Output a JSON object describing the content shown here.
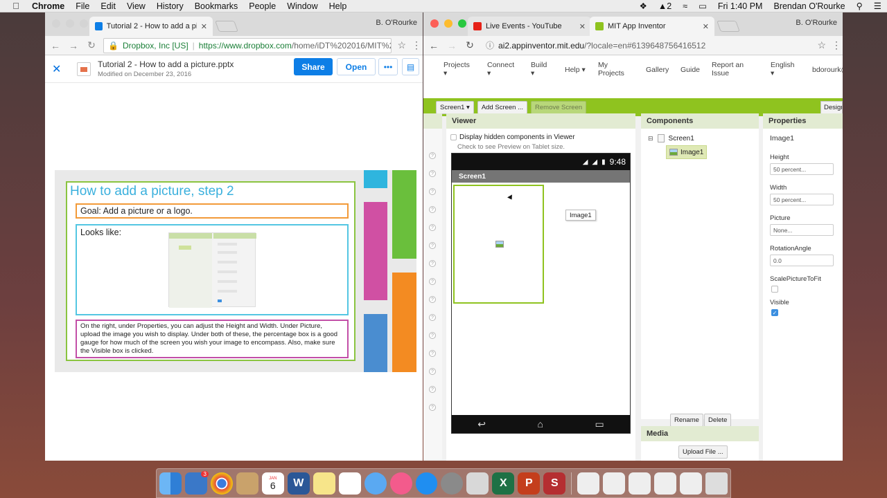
{
  "menubar": {
    "app": "Chrome",
    "items": [
      "File",
      "Edit",
      "View",
      "History",
      "Bookmarks",
      "People",
      "Window",
      "Help"
    ],
    "time": "Fri 1:40 PM",
    "user": "Brendan O'Rourke",
    "notification_count": "2"
  },
  "left_window": {
    "tab_title": "Tutorial 2 - How to add a pictu",
    "profile": "B. O'Rourke",
    "site_owner": "Dropbox, Inc [US]",
    "url_host": "https://www.dropbox.com",
    "url_path": "/home/iDT%202016/MIT%20A...",
    "file_title": "Tutorial 2 - How to add a picture.pptx",
    "file_modified": "Modified on December 23, 2016",
    "share_label": "Share",
    "open_label": "Open",
    "more_label": "•••",
    "slide": {
      "title": "How to add a picture, step 2",
      "goal": "Goal:  Add a picture or a logo.",
      "looks_like": "Looks like:",
      "paragraph": "On the right, under Properties, you can adjust the Height and Width.  Under Picture, upload the image you wish to display.  Under both of these, the percentage box is a good gauge for how much of the screen you wish your image to encompass.  Also, make sure the Visible box is clicked."
    }
  },
  "right_window": {
    "tabs": [
      {
        "title": "Live Events - YouTube"
      },
      {
        "title": "MIT App Inventor"
      }
    ],
    "profile": "B. O'Rourke",
    "url_host": "ai2.appinventor.mit.edu",
    "url_path": "/?locale=en#6139648756416512",
    "nav": {
      "projects": "Projects",
      "connect": "Connect",
      "build": "Build",
      "help": "Help",
      "my_projects_1": "My",
      "my_projects_2": "Projects",
      "gallery": "Gallery",
      "guide": "Guide",
      "report_1": "Report an",
      "report_2": "Issue",
      "language": "English",
      "user": "bdorourk@"
    },
    "toolbar": {
      "screen": "Screen1",
      "add_screen": "Add Screen ...",
      "remove_screen": "Remove Screen",
      "designer": "Designer"
    },
    "viewer": {
      "header": "Viewer",
      "display_hidden": "Display hidden components in Viewer",
      "tablet_preview": "Check to see Preview on Tablet size.",
      "phone_time": "9:48",
      "screen_title": "Screen1",
      "tooltip": "Image1"
    },
    "components": {
      "header": "Components",
      "screen": "Screen1",
      "image": "Image1",
      "rename": "Rename",
      "delete": "Delete"
    },
    "media": {
      "header": "Media",
      "upload": "Upload File ..."
    },
    "properties": {
      "header": "Properties",
      "component": "Image1",
      "height_label": "Height",
      "height_value": "50 percent...",
      "width_label": "Width",
      "width_value": "50 percent...",
      "picture_label": "Picture",
      "picture_value": "None...",
      "rotation_label": "RotationAngle",
      "rotation_value": "0.0",
      "scale_label": "ScalePictureToFit",
      "visible_label": "Visible",
      "scale_checked": false,
      "visible_checked": true
    }
  },
  "dock": {
    "calendar_month": "JAN",
    "calendar_day": "6",
    "mail_badge": "3"
  },
  "colors": {
    "ai_green": "#8fc31f",
    "dropbox_blue": "#0d7ee6",
    "slide_title": "#3ab0dd"
  }
}
